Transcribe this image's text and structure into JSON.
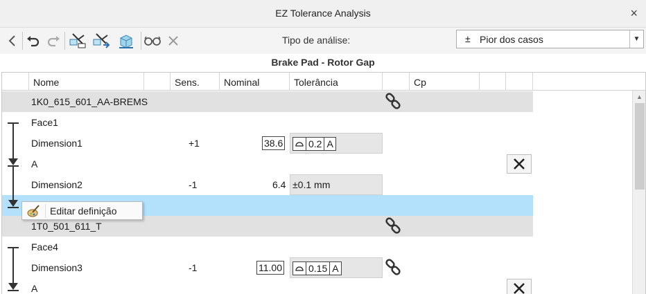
{
  "window": {
    "title": "EZ Tolerance Analysis",
    "close_glyph": "×"
  },
  "toolbar": {
    "analysis_type_label": "Tipo de análise:",
    "analysis_type_value": "Pior dos casos",
    "analysis_type_symbol": "±"
  },
  "analysis": {
    "title": "Brake Pad - Rotor Gap"
  },
  "table": {
    "headers": {
      "name": "Nome",
      "sens": "Sens.",
      "nominal": "Nominal",
      "tolerance": "Tolerância",
      "cp": "Cp"
    },
    "rows": [
      {
        "type": "group",
        "name": "1K0_615_601_AA-BREMS"
      },
      {
        "type": "face",
        "name": "Face1"
      },
      {
        "type": "dimension",
        "name": "Dimension1",
        "sens": "+1",
        "nominal": "38.6",
        "tol_value": "0.2",
        "tol_datum": "A"
      },
      {
        "type": "datum",
        "name": "A"
      },
      {
        "type": "dimension",
        "name": "Dimension2",
        "sens": "-1",
        "nominal": "6.4",
        "tol_text": "±0.1 mm"
      },
      {
        "type": "selected",
        "name": ""
      },
      {
        "type": "group",
        "name": "1T0_501_611_T"
      },
      {
        "type": "face",
        "name": "Face4"
      },
      {
        "type": "dimension",
        "name": "Dimension3",
        "sens": "-1",
        "nominal": "11.00",
        "tol_value": "0.15",
        "tol_datum": "A"
      },
      {
        "type": "datum",
        "name": "A"
      }
    ]
  },
  "context_menu": {
    "item_label": "Editar definição"
  },
  "colors": {
    "group_row": "#e1e1e1",
    "selected_row": "#b3e0fb"
  }
}
